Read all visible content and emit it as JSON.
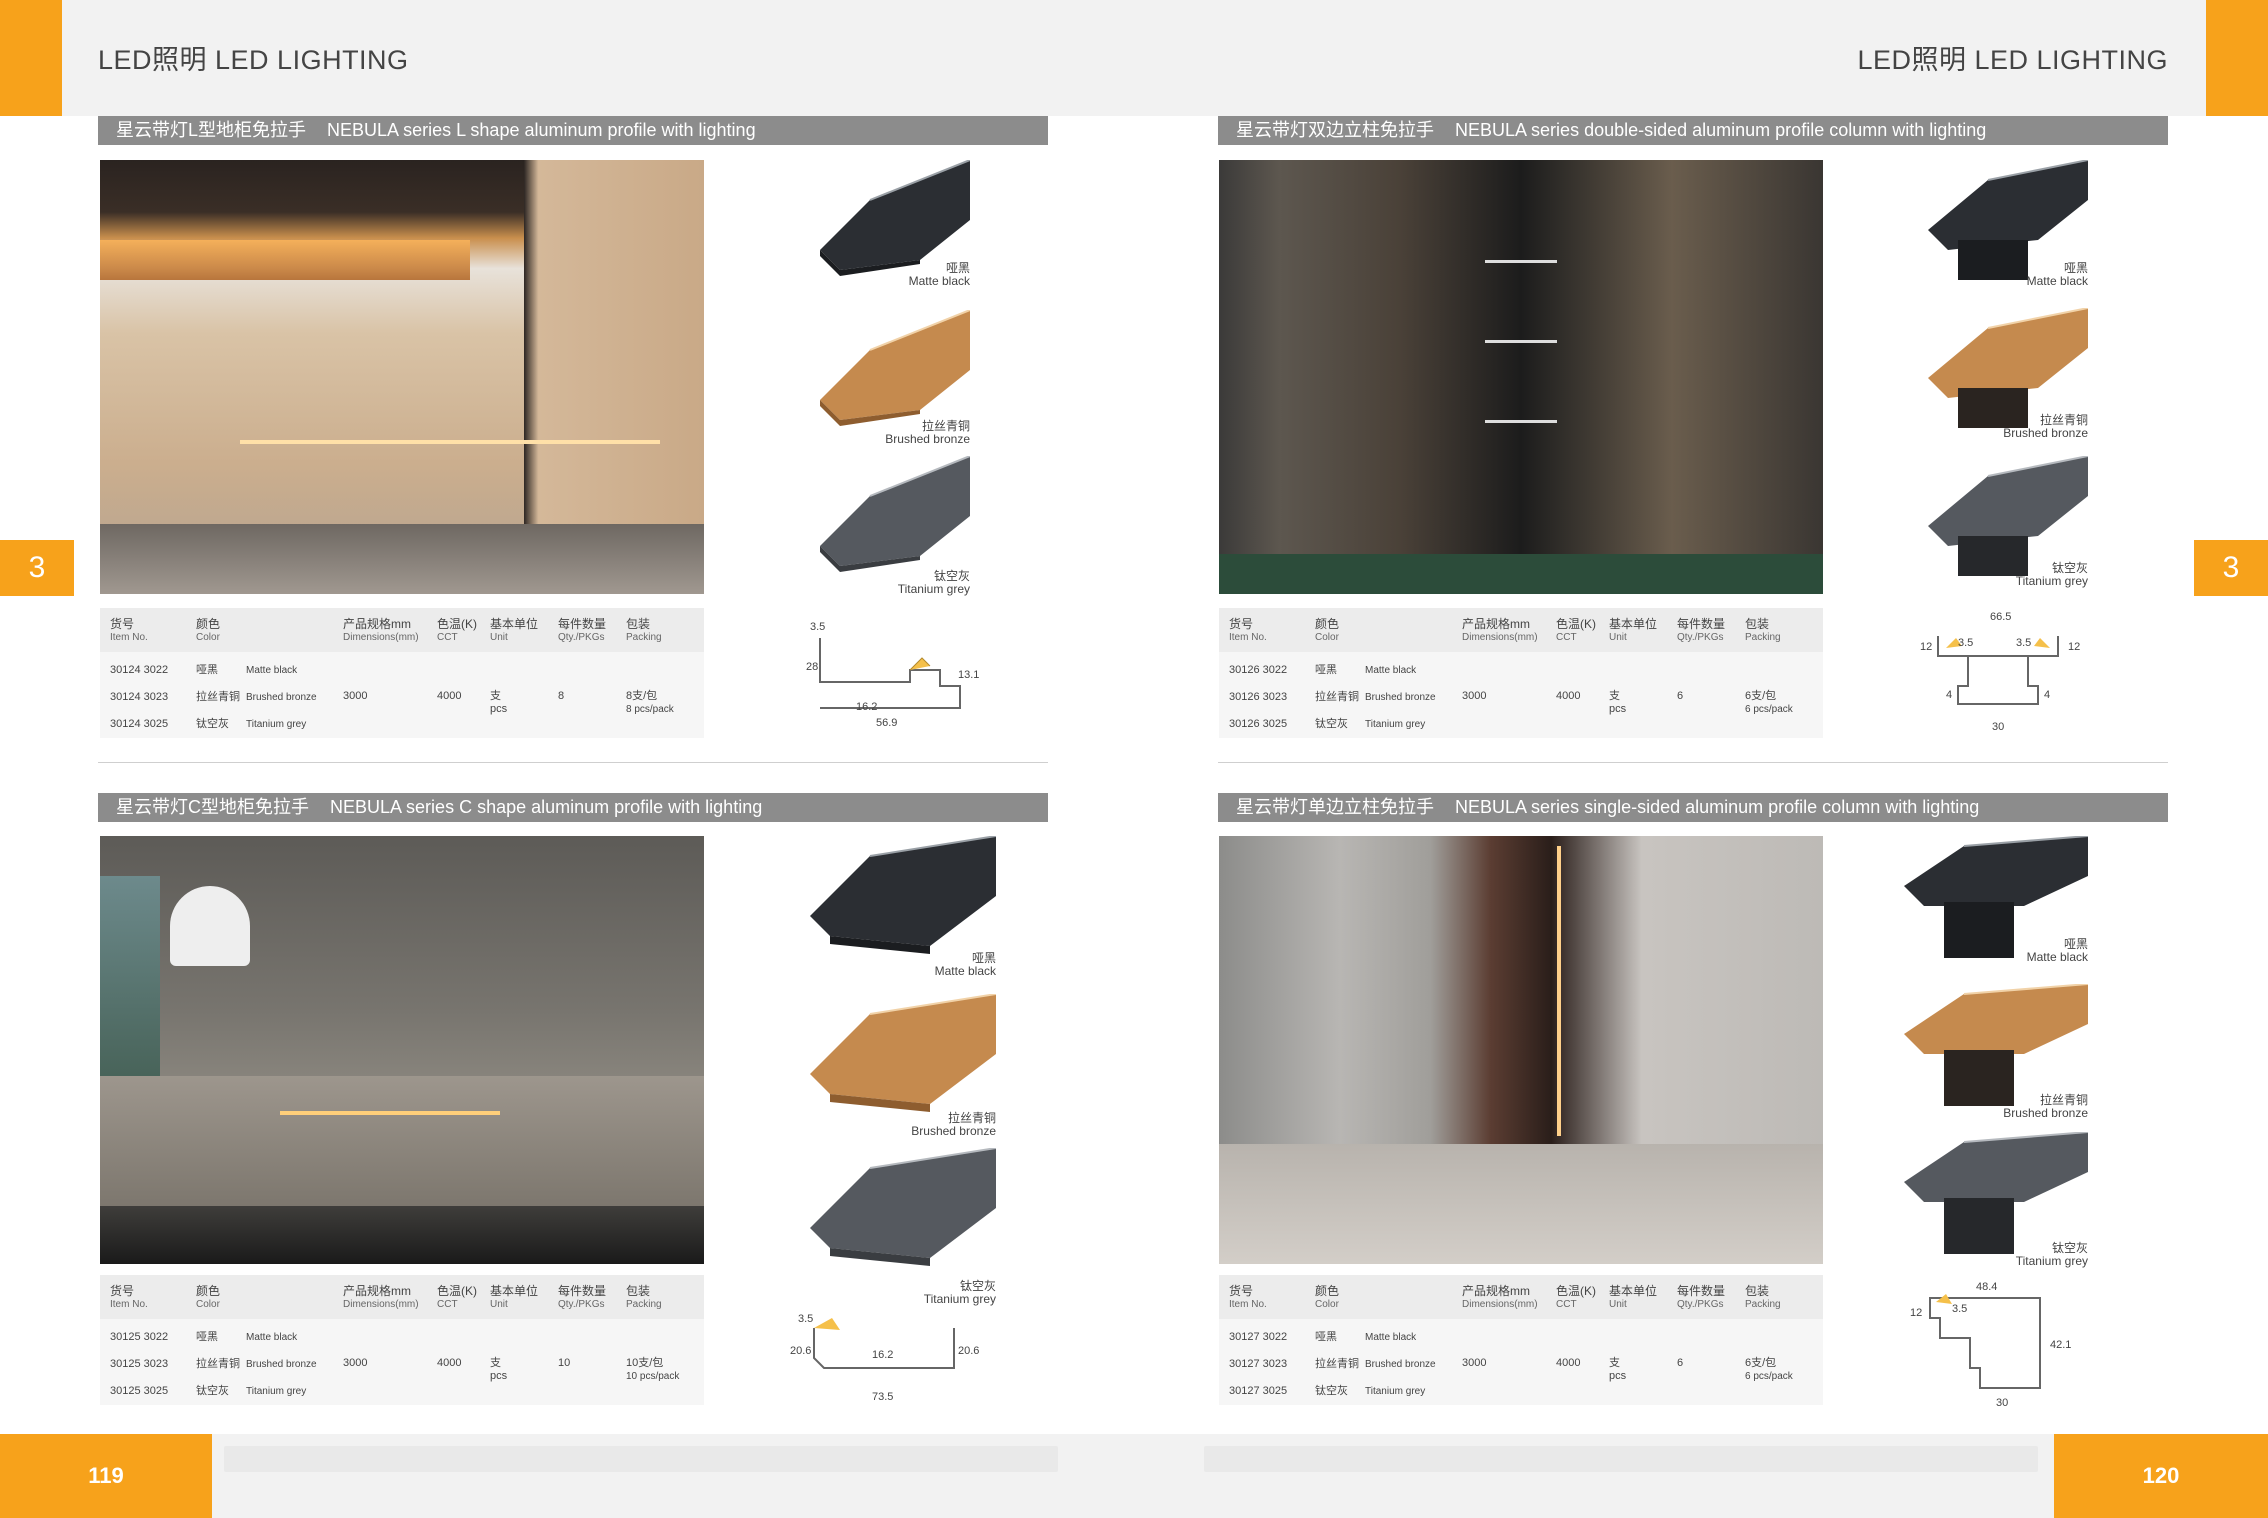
{
  "header": {
    "left_title": "LED照明  LED LIGHTING",
    "right_title": "LED照明  LED LIGHTING",
    "chapter_left": "3",
    "chapter_right": "3"
  },
  "sections": [
    {
      "title_cn": "星云带灯L型地柜免拉手",
      "title_en": "NEBULA series L shape aluminum profile with lighting",
      "finishes": [
        {
          "cn": "哑黑",
          "en": "Matte black"
        },
        {
          "cn": "拉丝青铜",
          "en": "Brushed bronze"
        },
        {
          "cn": "钛空灰",
          "en": "Titanium grey"
        }
      ],
      "table": {
        "headers": [
          {
            "cn": "货号",
            "en": "Item No."
          },
          {
            "cn": "颜色",
            "en": "Color"
          },
          {
            "cn": "产品规格mm",
            "en": "Dimensions(mm)"
          },
          {
            "cn": "色温(K)",
            "en": "CCT"
          },
          {
            "cn": "基本单位",
            "en": "Unit"
          },
          {
            "cn": "每件数量",
            "en": "Qty./PKGs"
          },
          {
            "cn": "包装",
            "en": "Packing"
          }
        ],
        "rows": [
          {
            "item": "30124 3022",
            "color_cn": "哑黑",
            "color_en": "Matte black"
          },
          {
            "item": "30124 3023",
            "color_cn": "拉丝青铜",
            "color_en": "Brushed bronze"
          },
          {
            "item": "30124 3025",
            "color_cn": "钛空灰",
            "color_en": "Titanium grey"
          }
        ],
        "dimensions": "3000",
        "cct": "4000",
        "unit_cn": "支",
        "unit_en": "pcs",
        "qty": "8",
        "packing_cn": "8支/包",
        "packing_en": "8 pcs/pack"
      },
      "dims": [
        "3.5",
        "28",
        "16.2",
        "56.9",
        "13.1"
      ]
    },
    {
      "title_cn": "星云带灯双边立柱免拉手",
      "title_en": "NEBULA series double-sided aluminum profile column with lighting",
      "finishes": [
        {
          "cn": "哑黑",
          "en": "Matte black"
        },
        {
          "cn": "拉丝青铜",
          "en": "Brushed bronze"
        },
        {
          "cn": "钛空灰",
          "en": "Titanium grey"
        }
      ],
      "table": {
        "headers": [
          {
            "cn": "货号",
            "en": "Item No."
          },
          {
            "cn": "颜色",
            "en": "Color"
          },
          {
            "cn": "产品规格mm",
            "en": "Dimensions(mm)"
          },
          {
            "cn": "色温(K)",
            "en": "CCT"
          },
          {
            "cn": "基本单位",
            "en": "Unit"
          },
          {
            "cn": "每件数量",
            "en": "Qty./PKGs"
          },
          {
            "cn": "包装",
            "en": "Packing"
          }
        ],
        "rows": [
          {
            "item": "30126 3022",
            "color_cn": "哑黑",
            "color_en": "Matte black"
          },
          {
            "item": "30126 3023",
            "color_cn": "拉丝青铜",
            "color_en": "Brushed bronze"
          },
          {
            "item": "30126 3025",
            "color_cn": "钛空灰",
            "color_en": "Titanium grey"
          }
        ],
        "dimensions": "3000",
        "cct": "4000",
        "unit_cn": "支",
        "unit_en": "pcs",
        "qty": "6",
        "packing_cn": "6支/包",
        "packing_en": "6 pcs/pack"
      },
      "dims": [
        "66.5",
        "3.5",
        "3.5",
        "12",
        "12",
        "4",
        "4",
        "30"
      ]
    },
    {
      "title_cn": "星云带灯C型地柜免拉手",
      "title_en": "NEBULA series C shape aluminum profile with lighting",
      "finishes": [
        {
          "cn": "哑黑",
          "en": "Matte black"
        },
        {
          "cn": "拉丝青铜",
          "en": "Brushed bronze"
        },
        {
          "cn": "钛空灰",
          "en": "Titanium grey"
        }
      ],
      "table": {
        "headers": [
          {
            "cn": "货号",
            "en": "Item No."
          },
          {
            "cn": "颜色",
            "en": "Color"
          },
          {
            "cn": "产品规格mm",
            "en": "Dimensions(mm)"
          },
          {
            "cn": "色温(K)",
            "en": "CCT"
          },
          {
            "cn": "基本单位",
            "en": "Unit"
          },
          {
            "cn": "每件数量",
            "en": "Qty./PKGs"
          },
          {
            "cn": "包装",
            "en": "Packing"
          }
        ],
        "rows": [
          {
            "item": "30125 3022",
            "color_cn": "哑黑",
            "color_en": "Matte black"
          },
          {
            "item": "30125 3023",
            "color_cn": "拉丝青铜",
            "color_en": "Brushed bronze"
          },
          {
            "item": "30125 3025",
            "color_cn": "钛空灰",
            "color_en": "Titanium grey"
          }
        ],
        "dimensions": "3000",
        "cct": "4000",
        "unit_cn": "支",
        "unit_en": "pcs",
        "qty": "10",
        "packing_cn": "10支/包",
        "packing_en": "10 pcs/pack"
      },
      "dims": [
        "3.5",
        "20.6",
        "16.2",
        "20.6",
        "73.5"
      ]
    },
    {
      "title_cn": "星云带灯单边立柱免拉手",
      "title_en": "NEBULA series single-sided aluminum profile column with lighting",
      "finishes": [
        {
          "cn": "哑黑",
          "en": "Matte black"
        },
        {
          "cn": "拉丝青铜",
          "en": "Brushed bronze"
        },
        {
          "cn": "钛空灰",
          "en": "Titanium grey"
        }
      ],
      "table": {
        "headers": [
          {
            "cn": "货号",
            "en": "Item No."
          },
          {
            "cn": "颜色",
            "en": "Color"
          },
          {
            "cn": "产品规格mm",
            "en": "Dimensions(mm)"
          },
          {
            "cn": "色温(K)",
            "en": "CCT"
          },
          {
            "cn": "基本单位",
            "en": "Unit"
          },
          {
            "cn": "每件数量",
            "en": "Qty./PKGs"
          },
          {
            "cn": "包装",
            "en": "Packing"
          }
        ],
        "rows": [
          {
            "item": "30127 3022",
            "color_cn": "哑黑",
            "color_en": "Matte black"
          },
          {
            "item": "30127 3023",
            "color_cn": "拉丝青铜",
            "color_en": "Brushed bronze"
          },
          {
            "item": "30127 3025",
            "color_cn": "钛空灰",
            "color_en": "Titanium grey"
          }
        ],
        "dimensions": "3000",
        "cct": "4000",
        "unit_cn": "支",
        "unit_en": "pcs",
        "qty": "6",
        "packing_cn": "6支/包",
        "packing_en": "6 pcs/pack"
      },
      "dims": [
        "48.4",
        "3.5",
        "12",
        "42.1",
        "30"
      ]
    }
  ],
  "footer": {
    "page_left": "119",
    "page_right": "120"
  },
  "colors": {
    "accent": "#f7a21b",
    "bar": "#8c8c8c",
    "matte_black": "#2b2e33",
    "brushed_bronze": "#c58a4e",
    "titanium_grey": "#55595f"
  }
}
